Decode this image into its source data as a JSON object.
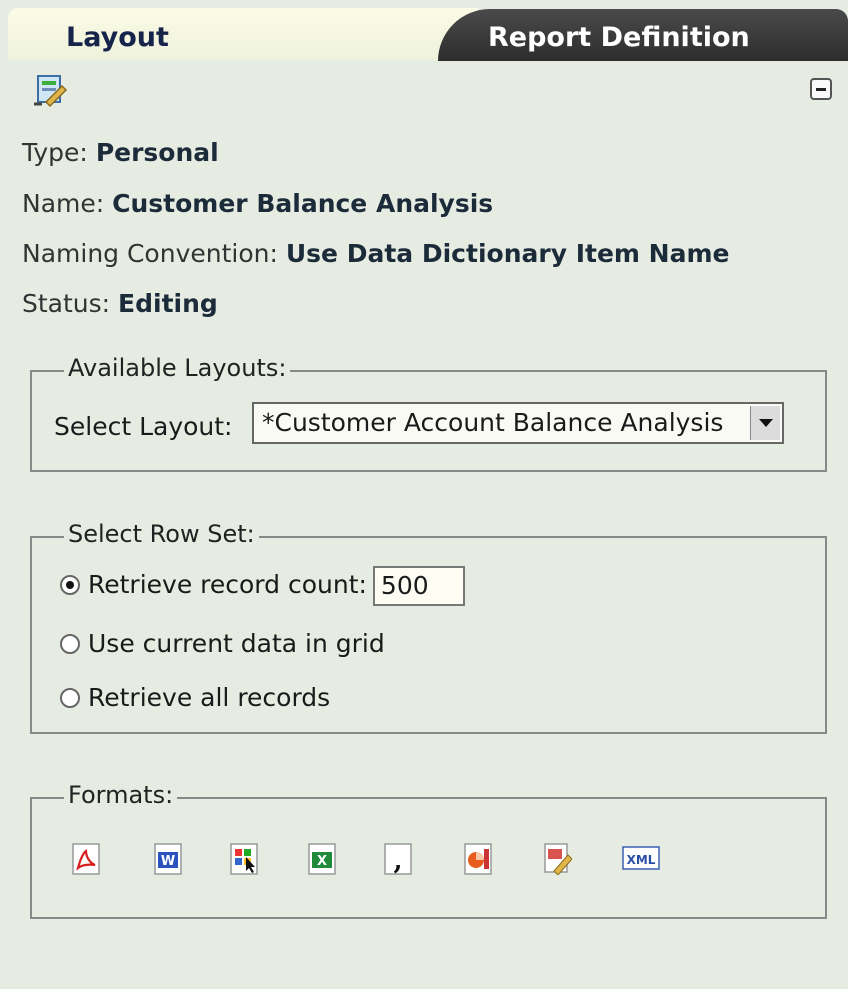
{
  "tabs": {
    "layout": "Layout",
    "report_definition": "Report Definition"
  },
  "info": {
    "type_label": "Type:",
    "type_value": "Personal",
    "name_label": "Name:",
    "name_value": "Customer Balance Analysis",
    "naming_label": "Naming Convention:",
    "naming_value": "Use Data Dictionary Item Name",
    "status_label": "Status:",
    "status_value": "Editing"
  },
  "available_layouts": {
    "legend": "Available Layouts:",
    "select_label": "Select Layout:",
    "selected": "*Customer Account Balance Analysis"
  },
  "row_set": {
    "legend": "Select Row Set:",
    "options": [
      {
        "label": "Retrieve record count:",
        "selected": true
      },
      {
        "label": "Use current data in grid",
        "selected": false
      },
      {
        "label": "Retrieve all records",
        "selected": false
      }
    ],
    "record_count": "500"
  },
  "formats": {
    "legend": "Formats:",
    "icons": [
      "pdf-icon",
      "word-icon",
      "interactive-icon",
      "excel-icon",
      "csv-icon",
      "powerpoint-icon",
      "edit-icon",
      "xml-icon"
    ]
  },
  "colors": {
    "background": "#e7ece2",
    "tab_active": "#fbfbe6",
    "tab_inactive": "#2d2d2d",
    "text_bold": "#1c2b3a"
  }
}
